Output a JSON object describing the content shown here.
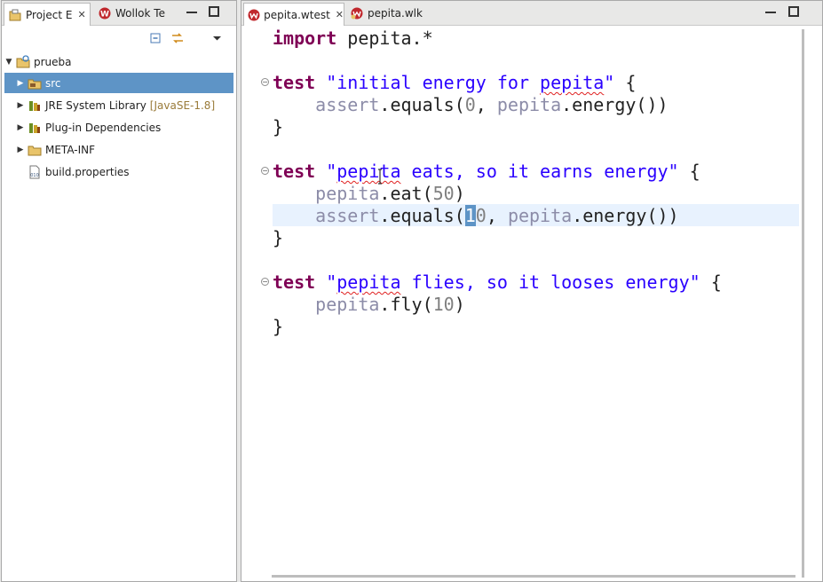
{
  "left_panel": {
    "tabs": [
      {
        "label": "Project E",
        "icon": "project-explorer-icon",
        "active": true
      },
      {
        "label": "Wollok Te",
        "icon": "wollok-icon",
        "active": false
      }
    ],
    "tree": [
      {
        "label": "prueba",
        "icon": "project-icon",
        "expanded": true,
        "depth": 0
      },
      {
        "label": "src",
        "icon": "source-folder-icon",
        "selected": true,
        "depth": 1
      },
      {
        "label": "JRE System Library",
        "decoration": "[JavaSE-1.8]",
        "icon": "library-icon",
        "depth": 1
      },
      {
        "label": "Plug-in Dependencies",
        "icon": "library-icon",
        "depth": 1
      },
      {
        "label": "META-INF",
        "icon": "folder-icon",
        "depth": 1
      },
      {
        "label": "build.properties",
        "icon": "properties-file-icon",
        "depth": 1
      }
    ]
  },
  "editor": {
    "tabs": [
      {
        "label": "pepita.wtest",
        "icon": "wollok-test-file-icon",
        "active": true
      },
      {
        "label": "pepita.wlk",
        "icon": "wollok-file-icon",
        "active": false
      }
    ],
    "code": {
      "l1_kw": "import",
      "l1_rest": " pepita.*",
      "t1_kw": "test",
      "t1_str_a": "\"initial energy for ",
      "t1_str_b": "pepita",
      "t1_str_c": "\"",
      "t1_brace": " {",
      "t1_assert": "assert",
      "t1_eq": ".equals(",
      "t1_num": "0",
      "t1_comma": ", ",
      "t1_obj": "pepita",
      "t1_energy": ".energy())",
      "close": "}",
      "t2_kw": "test",
      "t2_str_a": "\"",
      "t2_str_b": "pepita",
      "t2_str_c": " eats, so it earns energy\"",
      "t2_brace": " {",
      "t2_obj1": "pepita",
      "t2_eat": ".eat(",
      "t2_num1": "50",
      "t2_paren": ")",
      "t2_assert": "assert",
      "t2_eq": ".equals(",
      "t2_sel": "1",
      "t2_num2": "0",
      "t2_comma": ", ",
      "t2_obj2": "pepita",
      "t2_energy": ".energy())",
      "t3_kw": "test",
      "t3_str_a": "\"",
      "t3_str_b": "pepita",
      "t3_str_c": " flies, so it looses energy\"",
      "t3_brace": " {",
      "t3_obj": "pepita",
      "t3_fly": ".fly(",
      "t3_num": "10",
      "t3_paren": ")"
    }
  },
  "colors": {
    "keyword": "#7f0055",
    "string": "#2a00ff",
    "object": "#8c8ca8",
    "number": "#808080",
    "selection": "#5e94c6",
    "current_line": "#e8f2fe"
  }
}
